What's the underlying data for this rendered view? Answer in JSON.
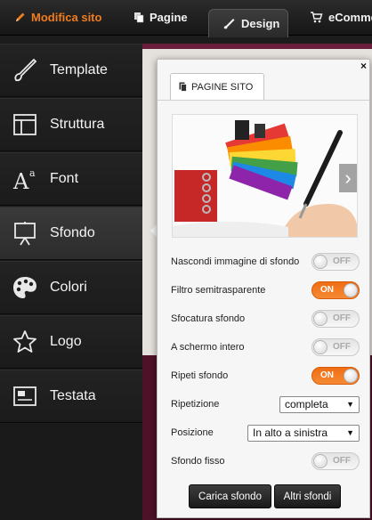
{
  "topnav": {
    "edit_label": "Modifica sito",
    "pages_label": "Pagine",
    "design_label": "Design",
    "ecommerce_label": "eCommerce",
    "accent_color": "#f07c1e"
  },
  "sidebar": {
    "items": [
      {
        "label": "Template",
        "icon": "brush-icon",
        "active": false
      },
      {
        "label": "Struttura",
        "icon": "layout-icon",
        "active": false
      },
      {
        "label": "Font",
        "icon": "font-icon",
        "active": false
      },
      {
        "label": "Sfondo",
        "icon": "easel-icon",
        "active": true
      },
      {
        "label": "Colori",
        "icon": "palette-icon",
        "active": false
      },
      {
        "label": "Logo",
        "icon": "star-icon",
        "active": false
      },
      {
        "label": "Testata",
        "icon": "header-image-icon",
        "active": false
      }
    ]
  },
  "panel": {
    "close_label": "×",
    "tab_label": "PAGINE SITO",
    "image_alt": "color swatches and pen",
    "next_label": "›",
    "settings": {
      "hide_image": {
        "label": "Nascondi immagine di sfondo",
        "state": "OFF"
      },
      "semi_transparent": {
        "label": "Filtro semitrasparente",
        "state": "ON"
      },
      "blur": {
        "label": "Sfocatura sfondo",
        "state": "OFF"
      },
      "fullscreen": {
        "label": "A schermo intero",
        "state": "OFF"
      },
      "repeat": {
        "label": "Ripeti sfondo",
        "state": "ON"
      },
      "repetition": {
        "label": "Ripetizione",
        "value": "completa"
      },
      "position": {
        "label": "Posizione",
        "value": "In alto a sinistra"
      },
      "fixed": {
        "label": "Sfondo fisso",
        "state": "OFF"
      }
    },
    "upload_button": "Carica sfondo",
    "more_button": "Altri sfondi",
    "toggle_on_color": "#f07c1e"
  }
}
